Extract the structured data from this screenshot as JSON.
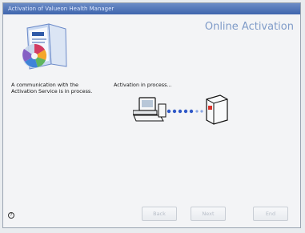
{
  "window": {
    "title": "Activation of Valueon Health Manager"
  },
  "header": {
    "title": "Online Activation"
  },
  "content": {
    "left_message": "A communication with the Activation Service is in process.",
    "status_message": "Activation in process..."
  },
  "buttons": {
    "back": "Back",
    "next": "Next",
    "end": "End"
  },
  "colors": {
    "title_bar": "#4f72b8",
    "heading": "#7f9bc8",
    "progress_dots": "#3d61c9"
  },
  "icons": {
    "help": "help-icon",
    "computer": "computer-icon",
    "server": "server-icon",
    "product": "product-box-icon"
  }
}
